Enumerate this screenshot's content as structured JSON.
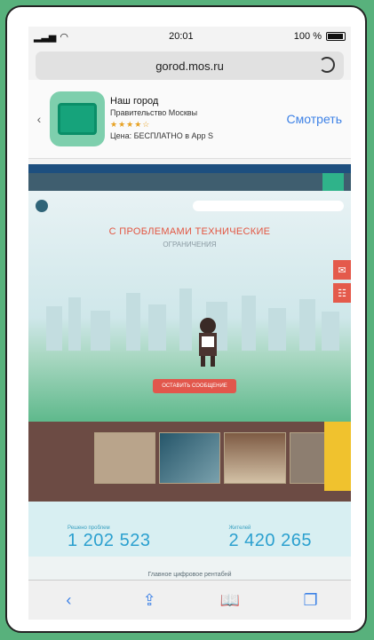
{
  "statusbar": {
    "time": "20:01",
    "battery": "100 %"
  },
  "browser": {
    "url": "gorod.mos.ru"
  },
  "app_banner": {
    "title": "Наш город",
    "publisher": "Правительство Москвы",
    "stars": "★★★★☆",
    "price_note": "Цена: БЕСПЛАТНО в App S",
    "view_label": "Смотреть"
  },
  "hero": {
    "headline": "С ПРОБЛЕМАМИ ТЕХНИЧЕСКИЕ",
    "subline": "ОГРАНИЧЕНИЯ",
    "cta_label": "ОСТАВИТЬ СООБЩЕНИЕ"
  },
  "stats": [
    {
      "label": "Решено проблем",
      "value": "1 202 523"
    },
    {
      "label": "Жителей",
      "value": "2 420 265"
    }
  ],
  "footer": {
    "link": "Главное цифровое рентабнй"
  }
}
